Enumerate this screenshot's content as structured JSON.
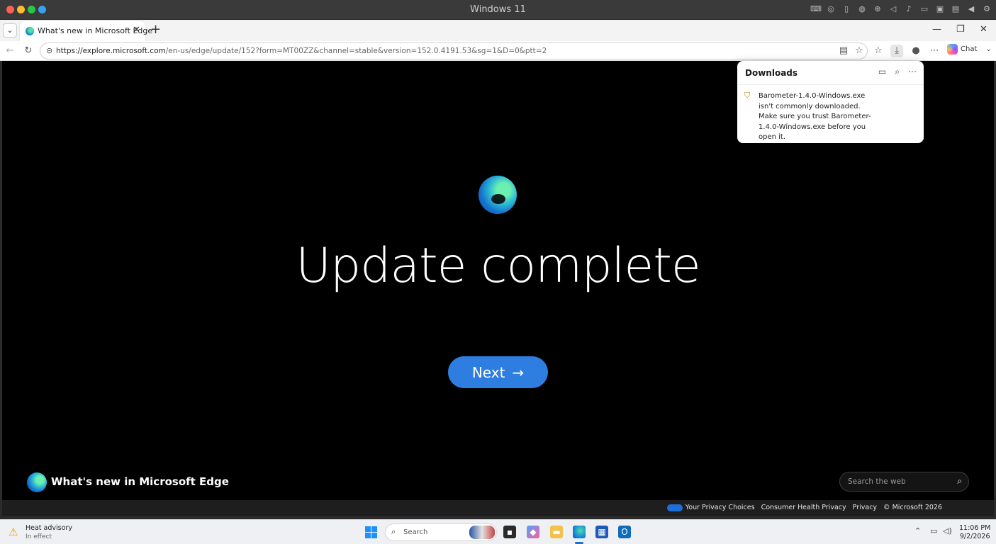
{
  "window": {
    "title": "Windows 11"
  },
  "tabs": [
    {
      "title": "What's new in Microsoft Edge"
    }
  ],
  "address_bar": {
    "host": "https://explore.microsoft.com",
    "path": "/en-us/edge/update/152?form=MT00ZZ&channel=stable&version=152.0.4191.53&sg=1&D=0&ptt=2"
  },
  "toolbar": {
    "chat_label": "Chat"
  },
  "downloads": {
    "title": "Downloads",
    "message": "Barometer-1.4.0-Windows.exe isn't commonly downloaded. Make sure you trust Barometer-1.4.0-Windows.exe before you open it."
  },
  "page": {
    "headline": "Update complete",
    "next_label": "Next",
    "next_arrow": "→",
    "footer_title": "What's new in Microsoft Edge",
    "search_placeholder": "Search the web",
    "legal": {
      "privacy_choices": "Your Privacy Choices",
      "consumer_health": "Consumer Health Privacy",
      "privacy": "Privacy",
      "copyright": "© Microsoft 2026"
    }
  },
  "taskbar": {
    "weather_title": "Heat advisory",
    "weather_sub": "In effect",
    "search_label": "Search",
    "time": "11:06 PM",
    "date": "9/2/2026"
  },
  "colors": {
    "accent_button": "#2e7de0",
    "page_background": "#000000"
  }
}
